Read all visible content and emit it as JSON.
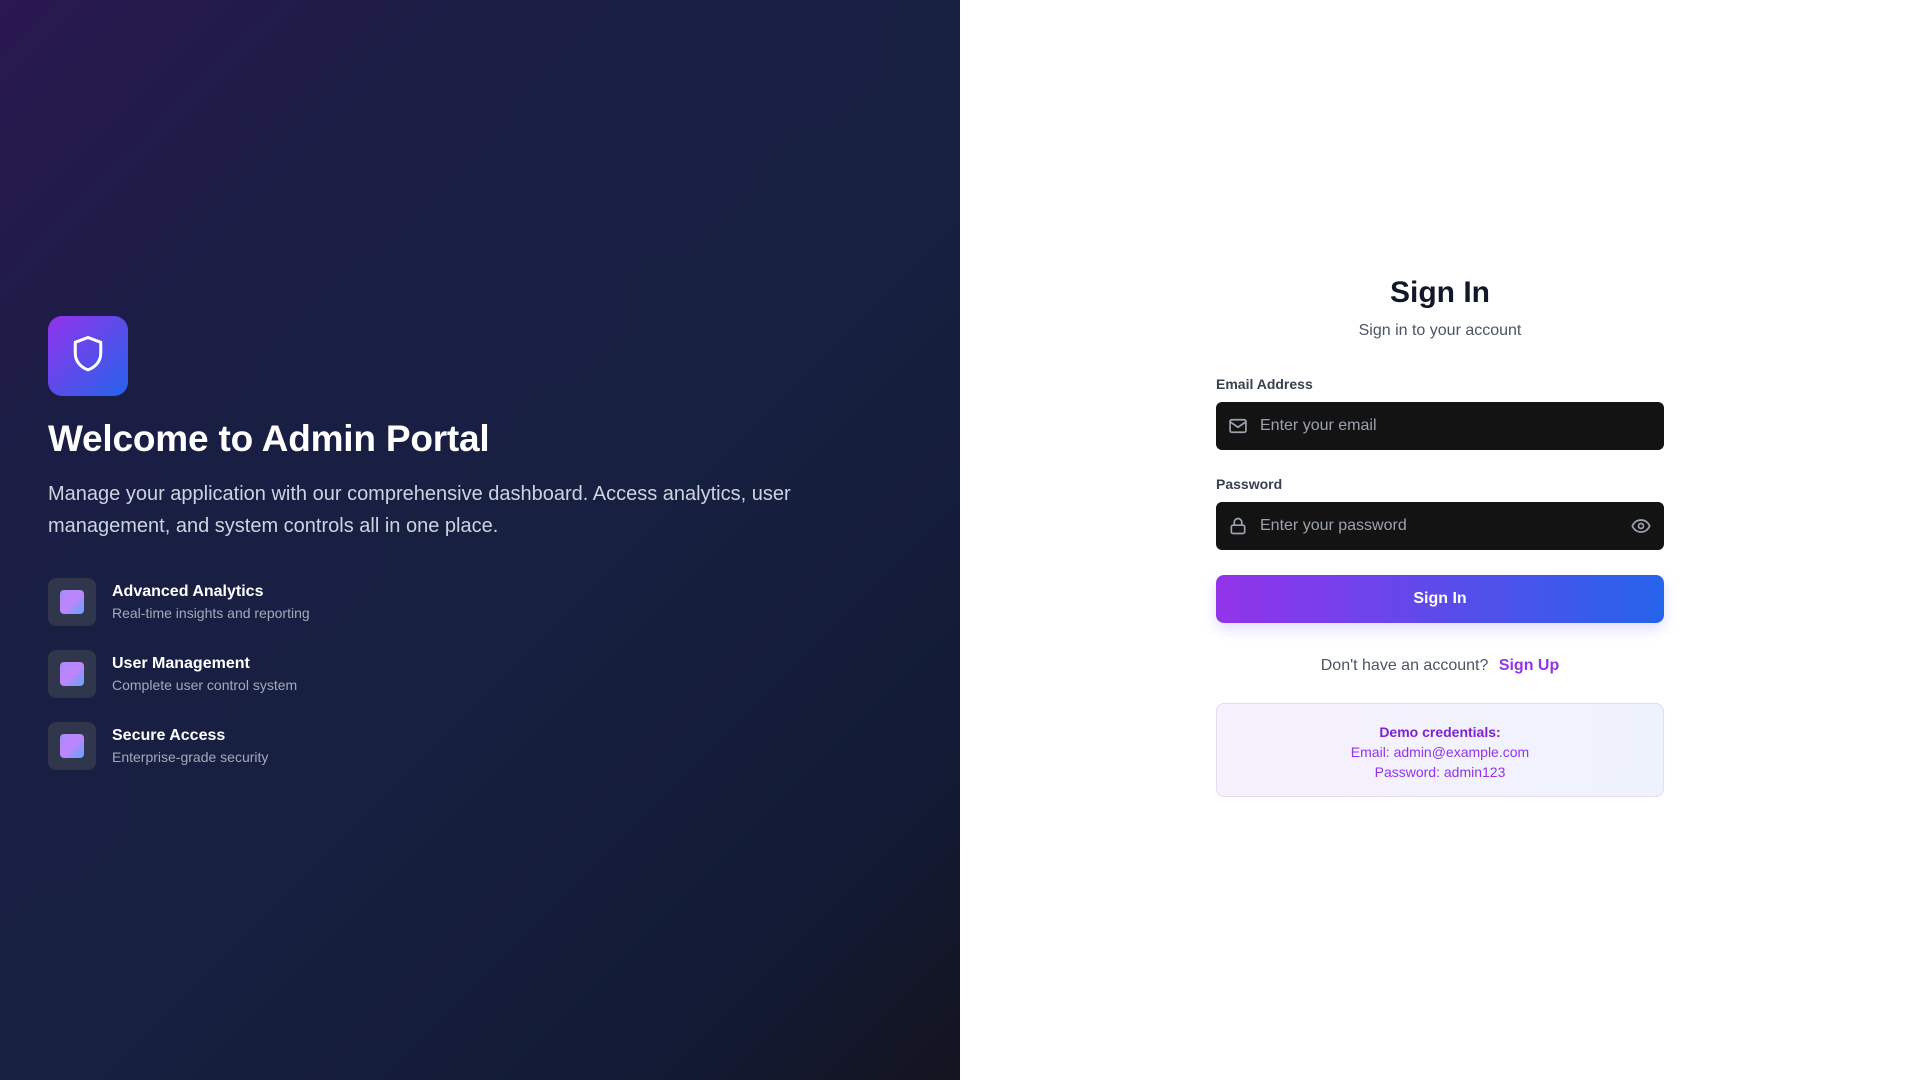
{
  "hero": {
    "title": "Welcome to Admin Portal",
    "description": "Manage your application with our comprehensive dashboard. Access analytics, user management, and system controls all in one place.",
    "logo_icon": "shield-icon",
    "features": [
      {
        "title": "Advanced Analytics",
        "description": "Real-time insights and reporting"
      },
      {
        "title": "User Management",
        "description": "Complete user control system"
      },
      {
        "title": "Secure Access",
        "description": "Enterprise-grade security"
      }
    ]
  },
  "form": {
    "title": "Sign In",
    "subtitle": "Sign in to your account",
    "email": {
      "label": "Email Address",
      "placeholder": "Enter your email",
      "value": "",
      "icon": "mail-icon"
    },
    "password": {
      "label": "Password",
      "placeholder": "Enter your password",
      "value": "",
      "icon": "lock-icon",
      "toggle_icon": "eye-icon"
    },
    "submit_label": "Sign In",
    "signup_prompt": "Don't have an account?",
    "signup_link": "Sign Up"
  },
  "demo": {
    "title": "Demo credentials:",
    "email_line": "Email: admin@example.com",
    "password_line": "Password: admin123"
  },
  "colors": {
    "accent_purple": "#9333ea",
    "accent_blue": "#2563eb",
    "left_panel_bg": "#172041",
    "input_bg": "#131313"
  }
}
